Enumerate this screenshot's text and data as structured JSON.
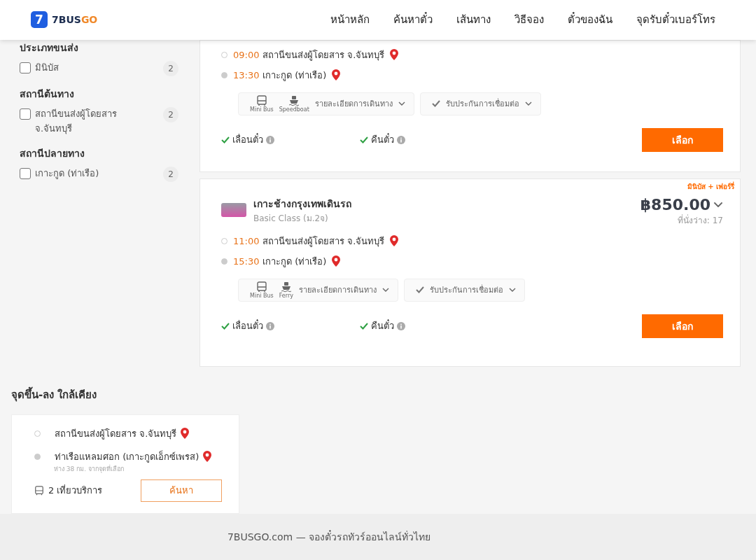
{
  "header": {
    "logo": {
      "text_main": "7BUS",
      "text_accent": "GO",
      "badge": "7"
    },
    "nav": [
      {
        "label": "หน้าหลัก"
      },
      {
        "label": "ค้นหาตั๋ว"
      },
      {
        "label": "เส้นทาง"
      },
      {
        "label": "วิธีจอง"
      },
      {
        "label": "ตั๋วของฉัน"
      },
      {
        "label": "จุดรับตั๋วเบอร์โทร"
      }
    ]
  },
  "filters": [
    {
      "title": "ประเภทขนส่ง",
      "options": [
        {
          "label": "มินิบัส",
          "count": "2",
          "checked": false
        }
      ]
    },
    {
      "title": "สถานีต้นทาง",
      "options": [
        {
          "label": "สถานีขนส่งผู้โดยสาร จ.จันทบุรี",
          "count": "2",
          "checked": false
        }
      ]
    },
    {
      "title": "สถานีปลายทาง",
      "options": [
        {
          "label": "เกาะกูด (ท่าเรือ)",
          "count": "2",
          "checked": false
        }
      ]
    }
  ],
  "trips": [
    {
      "stops": [
        {
          "time": "09:00",
          "place": "สถานีขนส่งผู้โดยสาร จ.จันทบุรี"
        },
        {
          "time": "13:30",
          "place": "เกาะกูด (ท่าเรือ)"
        }
      ],
      "vehicles": [
        {
          "kind": "bus",
          "label": "Mini Bus"
        },
        {
          "kind": "boat",
          "label": "Speedboat"
        }
      ],
      "details_label": "รายละเอียดการเดินทาง",
      "guarantee_label": "รับประกันการเชื่อมต่อ",
      "features": [
        {
          "label": "เลื่อนตั๋ว"
        },
        {
          "label": "คืนตั๋ว"
        }
      ],
      "select_label": "เลือก"
    },
    {
      "tag": "มินิบัส + เฟอร์รี่",
      "operator": "เกาะช้างกรุงเทพเดินรถ",
      "class": "Basic Class (ม.2จ)",
      "price": "฿850.00",
      "seats": "ที่นั่งว่าง: 17",
      "stops": [
        {
          "time": "11:00",
          "place": "สถานีขนส่งผู้โดยสาร จ.จันทบุรี"
        },
        {
          "time": "15:30",
          "place": "เกาะกูด (ท่าเรือ)"
        }
      ],
      "vehicles": [
        {
          "kind": "bus",
          "label": "Mini Bus"
        },
        {
          "kind": "boat",
          "label": "Ferry"
        }
      ],
      "details_label": "รายละเอียดการเดินทาง",
      "guarantee_label": "รับประกันการเชื่อมต่อ",
      "features": [
        {
          "label": "เลื่อนตั๋ว"
        },
        {
          "label": "คืนตั๋ว"
        }
      ],
      "select_label": "เลือก"
    }
  ],
  "nearby": {
    "title": "จุดขึ้น-ลง ใกล้เคียง",
    "stops": [
      {
        "place": "สถานีขนส่งผู้โดยสาร จ.จันทบุรี"
      },
      {
        "place": "ท่าเรือแหลมศอก (เกาะกูดเอ็กซ์เพรส)",
        "note": "ห่าง 38 กม. จากจุดที่เลือก"
      }
    ],
    "trips_count": "2 เที่ยวบริการ",
    "button": "ค้นหา"
  },
  "footer": {
    "text": "7BUSGO.com — จองตั๋วรถทัวร์ออนไลน์ทั่วไทย"
  }
}
